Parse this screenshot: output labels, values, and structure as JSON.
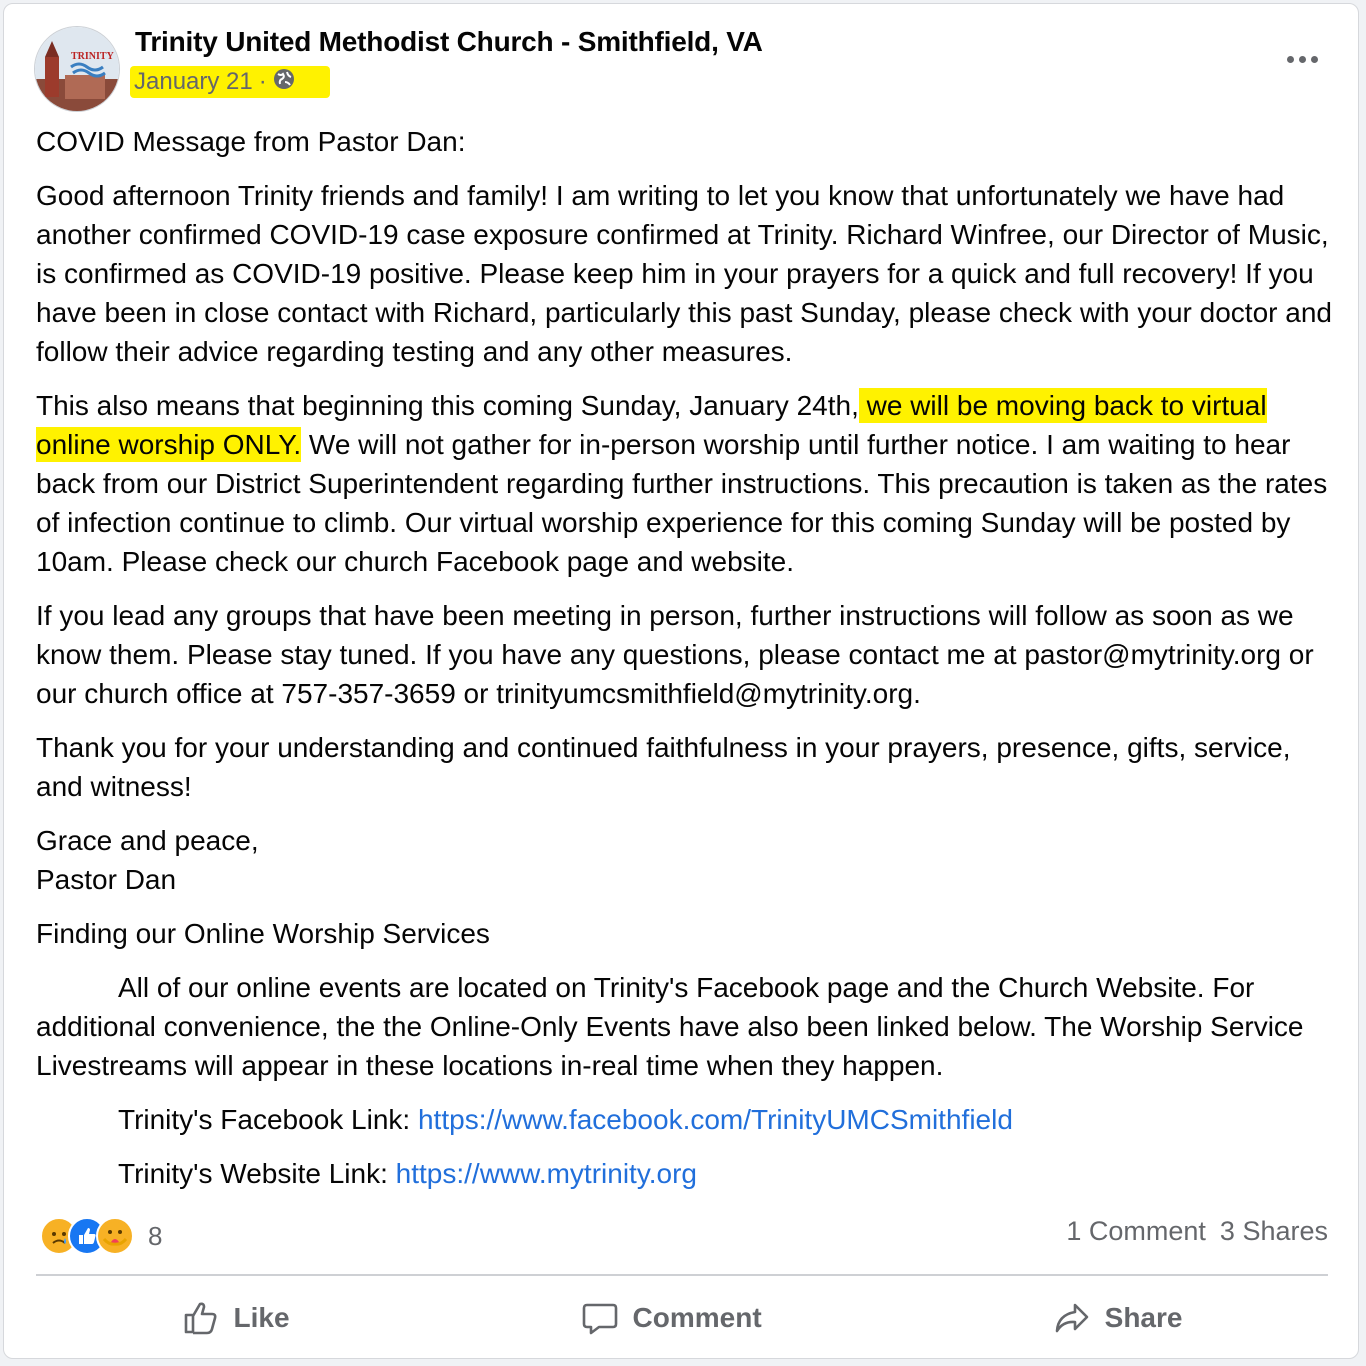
{
  "post": {
    "author": "Trinity United Methodist Church - Smithfield, VA",
    "date": "January 21",
    "date_separator": "·",
    "privacy_icon": "globe-icon",
    "avatar_text": "TRINITY",
    "highlight_color": "#fff200"
  },
  "body": {
    "p1": "COVID Message from Pastor Dan:",
    "p2": "Good afternoon Trinity friends and family! I am writing to let you know that unfortunately we have had another confirmed COVID-19 case exposure confirmed at Trinity. Richard Winfree, our Director of Music, is confirmed as COVID-19 positive. Please keep him in your prayers for a quick and full recovery! If you have been in close contact with Richard, particularly this past Sunday, please check with your doctor and follow their advice regarding testing and any other measures.",
    "p3_before": "This also means that beginning this coming Sunday, January 24th,",
    "p3_highlight": " we will be moving back to virtual online worship ONLY.",
    "p3_after": " We will not gather for in-person worship until further notice. I am waiting to hear back from our District Superintendent regarding further instructions. This precaution is taken as the rates of infection continue to climb. Our virtual worship experience for this coming Sunday will be posted by 10am. Please check our church Facebook page and website.",
    "p4": "If you lead any groups that have been meeting in person, further instructions will follow as soon as we know them. Please stay tuned. If you have any questions, please contact me at pastor@mytrinity.org or our church office at 757-357-3659 or trinityumcsmithfield@mytrinity.org.",
    "p5": "Thank you for your understanding and continued faithfulness in your prayers, presence, gifts, service, and witness!",
    "signoff_1": "Grace and peace,",
    "signoff_2": "Pastor Dan",
    "section_title": "Finding our Online Worship Services",
    "p6": "All of our online events are located on Trinity's Facebook page and the Church Website. For additional convenience, the the Online-Only Events have also been linked below. The Worship Service Livestreams will appear in these locations in-real time when they happen.",
    "fb_label": "Trinity's Facebook Link: ",
    "fb_url": "https://www.facebook.com/TrinityUMCSmithfield",
    "web_label": "Trinity's Website Link: ",
    "web_url": "https://www.mytrinity.org"
  },
  "reactions": {
    "icons": [
      "sad-icon",
      "like-icon",
      "care-icon"
    ],
    "count": "8"
  },
  "stats": {
    "comments": "1 Comment",
    "shares": "3 Shares"
  },
  "actions": {
    "like": "Like",
    "comment": "Comment",
    "share": "Share"
  }
}
